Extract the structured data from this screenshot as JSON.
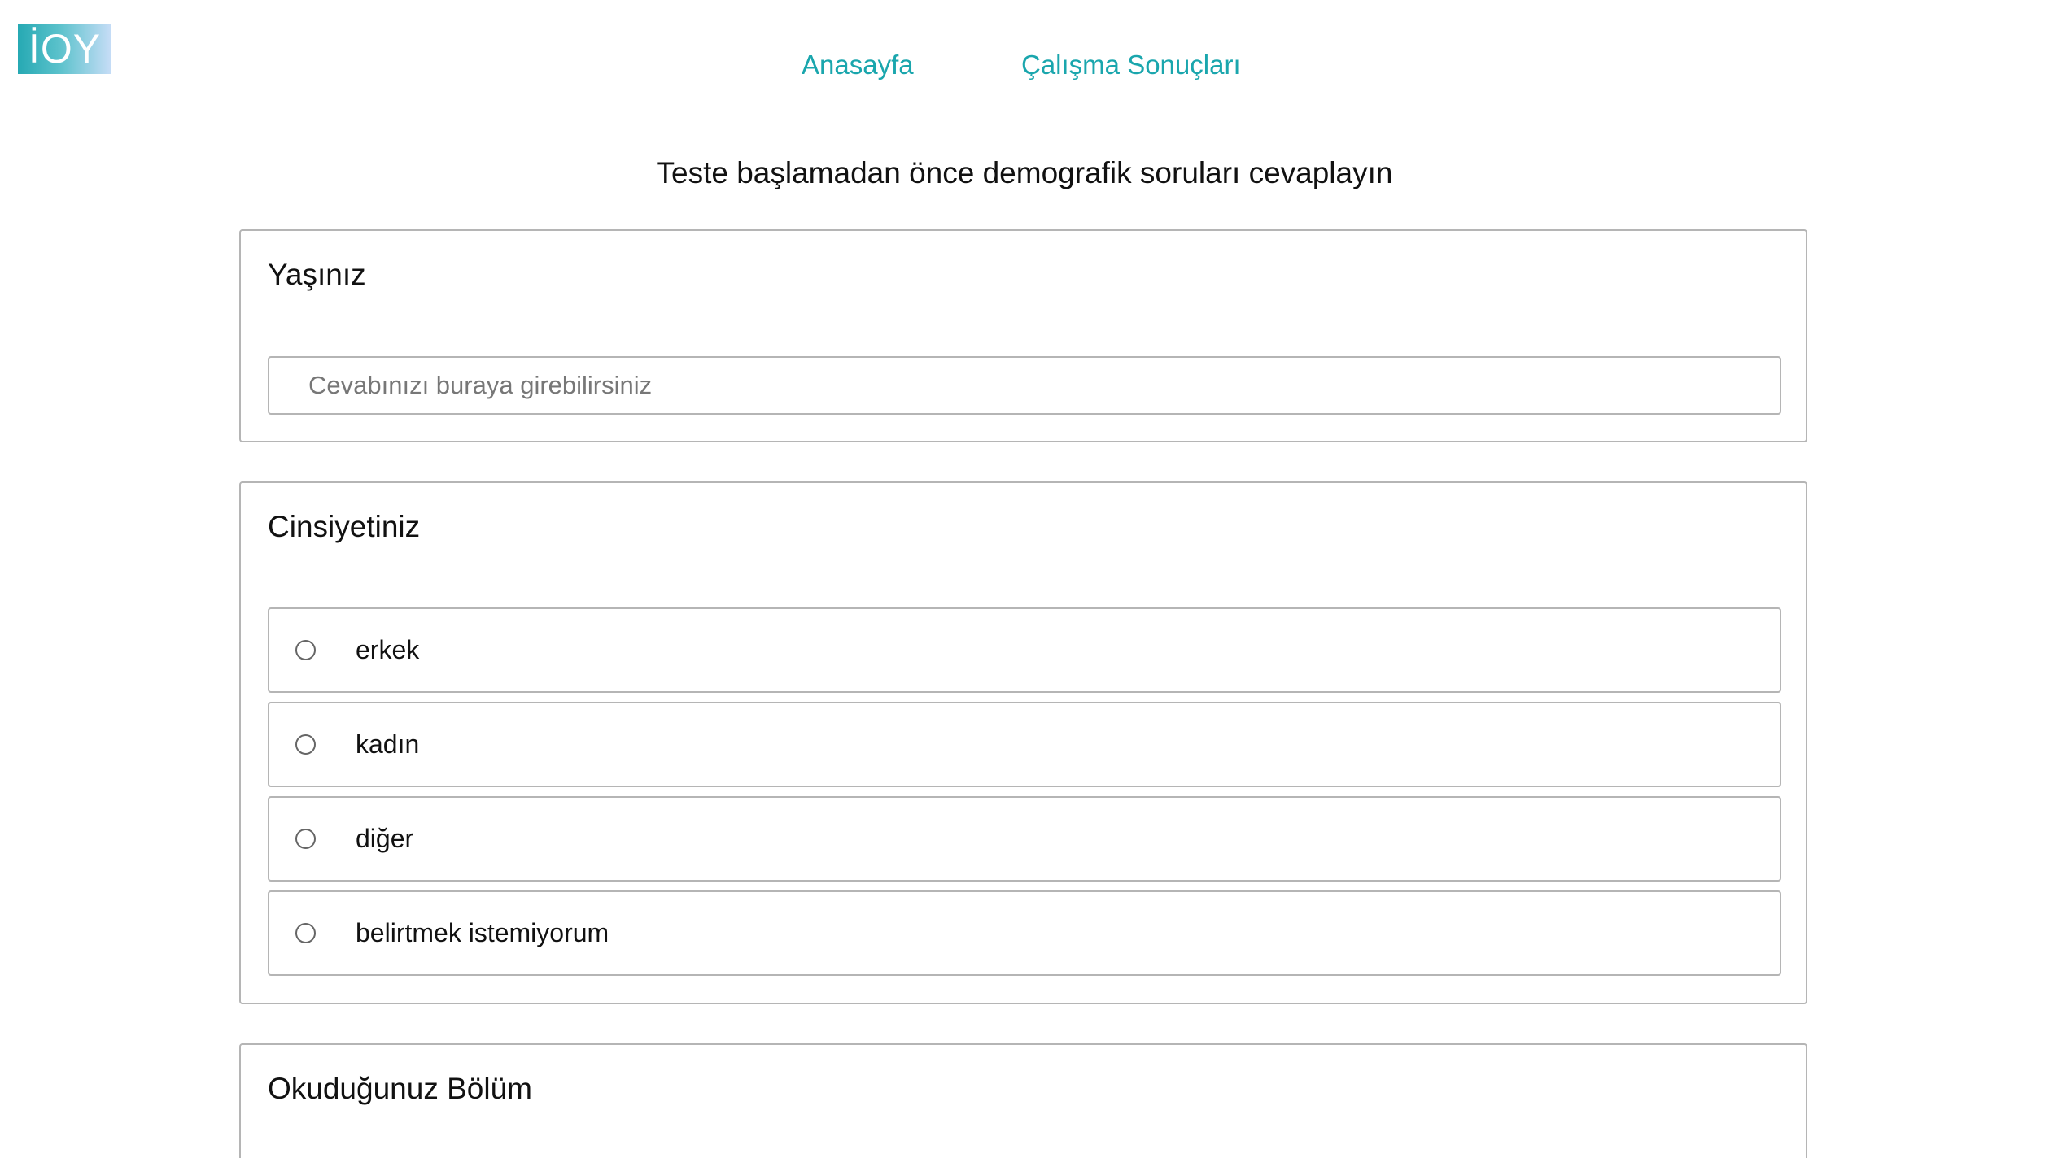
{
  "logo": {
    "text": "İOY"
  },
  "nav": {
    "home": "Anasayfa",
    "results": "Çalışma Sonuçları"
  },
  "heading": "Teste başlamadan önce demografik soruları cevaplayın",
  "questions": [
    {
      "title": "Yaşınız",
      "input_value": "",
      "placeholder": "Cevabınızı buraya girebilirsiniz"
    },
    {
      "title": "Cinsiyetiniz",
      "options": [
        "erkek",
        "kadın",
        "diğer",
        "belirtmek istemiyorum"
      ],
      "selected": null
    },
    {
      "title": "Okuduğunuz Bölüm"
    }
  ],
  "colors": {
    "accent": "#1aa6ad",
    "border": "#b5b5b5",
    "logo_gradient_start": "#26a9b3",
    "logo_gradient_end": "#c7ddf7"
  }
}
